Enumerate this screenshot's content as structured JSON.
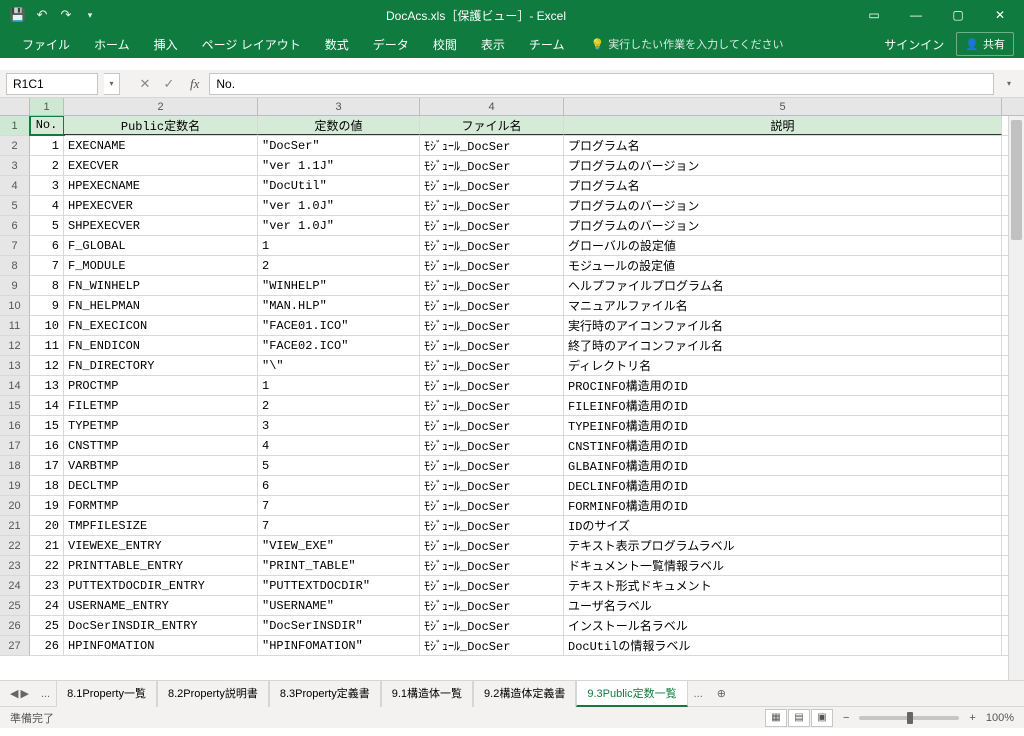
{
  "title": "DocAcs.xls［保護ビュー］- Excel",
  "qat": {
    "save": "save-icon",
    "undo": "undo-icon",
    "redo": "redo-icon",
    "customize": "chevron-down-icon"
  },
  "window": {
    "ribbon_opts": "▢",
    "minimize": "—",
    "maximize": "▢",
    "close": "✕"
  },
  "tabs": [
    "ファイル",
    "ホーム",
    "挿入",
    "ページ レイアウト",
    "数式",
    "データ",
    "校閲",
    "表示",
    "チーム"
  ],
  "tellme": {
    "icon": "💡",
    "text": "実行したい作業を入力してください"
  },
  "signin": "サインイン",
  "share": {
    "icon": "👤",
    "label": "共有"
  },
  "namebox": "R1C1",
  "fx_value": "No.",
  "col_nums": [
    "1",
    "2",
    "3",
    "4",
    "5"
  ],
  "headers": [
    "No.",
    "Public定数名",
    "定数の値",
    "ファイル名",
    "説明"
  ],
  "rows": [
    {
      "n": "1",
      "a": "EXECNAME",
      "b": "\"DocSer\"",
      "c": "ﾓｼﾞｭｰﾙ_DocSer",
      "d": "プログラム名"
    },
    {
      "n": "2",
      "a": "EXECVER",
      "b": "\"ver 1.1J\"",
      "c": "ﾓｼﾞｭｰﾙ_DocSer",
      "d": "プログラムのバージョン"
    },
    {
      "n": "3",
      "a": "HPEXECNAME",
      "b": "\"DocUtil\"",
      "c": "ﾓｼﾞｭｰﾙ_DocSer",
      "d": "プログラム名"
    },
    {
      "n": "4",
      "a": "HPEXECVER",
      "b": "\"ver 1.0J\"",
      "c": "ﾓｼﾞｭｰﾙ_DocSer",
      "d": "プログラムのバージョン"
    },
    {
      "n": "5",
      "a": "SHPEXECVER",
      "b": "\"ver 1.0J\"",
      "c": "ﾓｼﾞｭｰﾙ_DocSer",
      "d": "プログラムのバージョン"
    },
    {
      "n": "6",
      "a": "F_GLOBAL",
      "b": "1",
      "c": "ﾓｼﾞｭｰﾙ_DocSer",
      "d": "グローバルの設定値"
    },
    {
      "n": "7",
      "a": "F_MODULE",
      "b": "2",
      "c": "ﾓｼﾞｭｰﾙ_DocSer",
      "d": "モジュールの設定値"
    },
    {
      "n": "8",
      "a": "FN_WINHELP",
      "b": "\"WINHELP\"",
      "c": "ﾓｼﾞｭｰﾙ_DocSer",
      "d": "ヘルプファイルプログラム名"
    },
    {
      "n": "9",
      "a": "FN_HELPMAN",
      "b": "\"MAN.HLP\"",
      "c": "ﾓｼﾞｭｰﾙ_DocSer",
      "d": "マニュアルファイル名"
    },
    {
      "n": "10",
      "a": "FN_EXECICON",
      "b": "\"FACE01.ICO\"",
      "c": "ﾓｼﾞｭｰﾙ_DocSer",
      "d": "実行時のアイコンファイル名"
    },
    {
      "n": "11",
      "a": "FN_ENDICON",
      "b": "\"FACE02.ICO\"",
      "c": "ﾓｼﾞｭｰﾙ_DocSer",
      "d": "終了時のアイコンファイル名"
    },
    {
      "n": "12",
      "a": "FN_DIRECTORY",
      "b": "\"\\\"",
      "c": "ﾓｼﾞｭｰﾙ_DocSer",
      "d": "ディレクトリ名"
    },
    {
      "n": "13",
      "a": "PROCTMP",
      "b": "1",
      "c": "ﾓｼﾞｭｰﾙ_DocSer",
      "d": "PROCINFO構造用のID"
    },
    {
      "n": "14",
      "a": "FILETMP",
      "b": "2",
      "c": "ﾓｼﾞｭｰﾙ_DocSer",
      "d": "FILEINFO構造用のID"
    },
    {
      "n": "15",
      "a": "TYPETMP",
      "b": "3",
      "c": "ﾓｼﾞｭｰﾙ_DocSer",
      "d": "TYPEINFO構造用のID"
    },
    {
      "n": "16",
      "a": "CNSTTMP",
      "b": "4",
      "c": "ﾓｼﾞｭｰﾙ_DocSer",
      "d": "CNSTINFO構造用のID"
    },
    {
      "n": "17",
      "a": "VARBTMP",
      "b": "5",
      "c": "ﾓｼﾞｭｰﾙ_DocSer",
      "d": "GLBAINFO構造用のID"
    },
    {
      "n": "18",
      "a": "DECLTMP",
      "b": "6",
      "c": "ﾓｼﾞｭｰﾙ_DocSer",
      "d": "DECLINFO構造用のID"
    },
    {
      "n": "19",
      "a": "FORMTMP",
      "b": "7",
      "c": "ﾓｼﾞｭｰﾙ_DocSer",
      "d": "FORMINFO構造用のID"
    },
    {
      "n": "20",
      "a": "TMPFILESIZE",
      "b": "7",
      "c": "ﾓｼﾞｭｰﾙ_DocSer",
      "d": "IDのサイズ"
    },
    {
      "n": "21",
      "a": "VIEWEXE_ENTRY",
      "b": "\"VIEW_EXE\"",
      "c": "ﾓｼﾞｭｰﾙ_DocSer",
      "d": "テキスト表示プログラムラベル"
    },
    {
      "n": "22",
      "a": "PRINTTABLE_ENTRY",
      "b": "\"PRINT_TABLE\"",
      "c": "ﾓｼﾞｭｰﾙ_DocSer",
      "d": "ドキュメント一覧情報ラベル"
    },
    {
      "n": "23",
      "a": "PUTTEXTDOCDIR_ENTRY",
      "b": "\"PUTTEXTDOCDIR\"",
      "c": "ﾓｼﾞｭｰﾙ_DocSer",
      "d": "テキスト形式ドキュメント"
    },
    {
      "n": "24",
      "a": "USERNAME_ENTRY",
      "b": "\"USERNAME\"",
      "c": "ﾓｼﾞｭｰﾙ_DocSer",
      "d": "ユーザ名ラベル"
    },
    {
      "n": "25",
      "a": "DocSerINSDIR_ENTRY",
      "b": "\"DocSerINSDIR\"",
      "c": "ﾓｼﾞｭｰﾙ_DocSer",
      "d": "インストール名ラベル"
    },
    {
      "n": "26",
      "a": "HPINFOMATION",
      "b": "\"HPINFOMATION\"",
      "c": "ﾓｼﾞｭｰﾙ_DocSer",
      "d": "DocUtilの情報ラベル"
    }
  ],
  "sheets": [
    "8.1Property一覧",
    "8.2Property説明書",
    "8.3Property定義書",
    "9.1構造体一覧",
    "9.2構造体定義書",
    "9.3Public定数一覧"
  ],
  "active_sheet": 5,
  "status": "準備完了",
  "zoom": "100%",
  "zoom_minus": "−",
  "zoom_plus": "+",
  "ellipsis": "..."
}
